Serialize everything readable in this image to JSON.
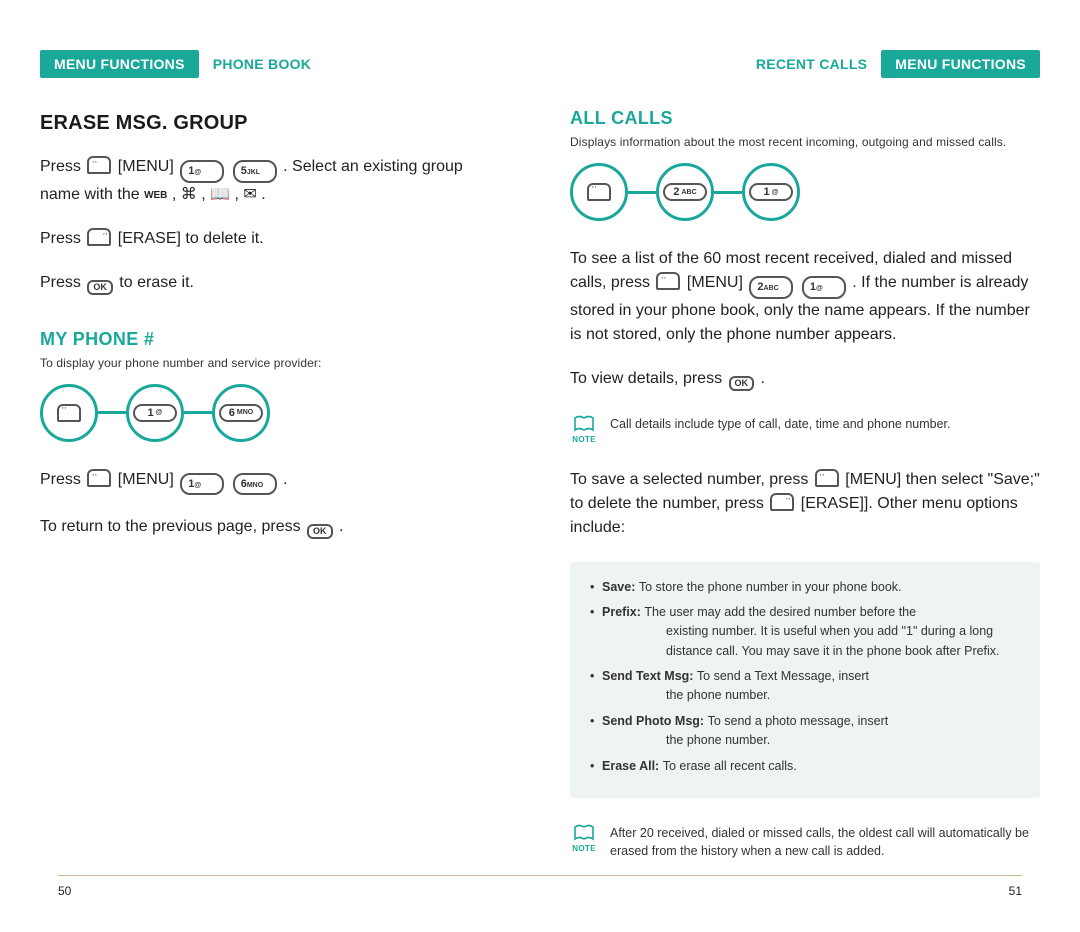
{
  "left": {
    "header": {
      "pill": "MENU FUNCTIONS",
      "sub": "PHONE BOOK"
    },
    "title": "ERASE MSG. GROUP",
    "erase_line1a": "Press ",
    "erase_line1b": " [MENU] ",
    "erase_line1c": " . Select an existing group",
    "erase_line2a": "name with the ",
    "erase_web": "WEB",
    "erase_glyphs": " , ⌘ , 📖 , ✉ .",
    "erase_line3a": "Press ",
    "erase_line3b": " [ERASE] to delete it.",
    "erase_line4a": "Press ",
    "erase_line4b": "  to erase it.",
    "myphone_title": "MY PHONE #",
    "myphone_desc": "To display your phone number and service provider:",
    "steps": {
      "k2": {
        "main": "1",
        "sub": "@"
      },
      "k3": {
        "main": "6",
        "sub": "MNO"
      }
    },
    "p1a": "Press ",
    "p1b": " [MENU] ",
    "p1c": " .",
    "p2a": "To return to the previous page, press ",
    "p2b": "  .",
    "page": "50"
  },
  "right": {
    "header": {
      "sub": "RECENT CALLS",
      "pill": "MENU FUNCTIONS"
    },
    "title": "ALL CALLS",
    "desc": "Displays information about the most recent incoming, outgoing and missed calls.",
    "steps": {
      "k2": {
        "main": "2",
        "sub": "ABC"
      },
      "k3": {
        "main": "1",
        "sub": "@"
      }
    },
    "body1a": "To see a list of the 60 most recent received, dialed and missed calls, press ",
    "body1b": " [MENU] ",
    "body1c": " . If the number is already stored in your phone book, only the name appears. If the number is not stored, only the phone number appears.",
    "body2a": "To view details, press ",
    "body2b": "  .",
    "note1": "Call details include type of call, date, time and phone number.",
    "body3a": "To save a selected number, press ",
    "body3b": " [MENU] then select \"Save;\" to delete the number, press ",
    "body3c": " [ERASE]].  Other menu options include:",
    "options": [
      {
        "name": "Save:",
        "text": "To store the phone number in your phone book."
      },
      {
        "name": "Prefix:",
        "text": "The user may add the desired number before the existing number. It is useful when you add \"1\" during a long distance call. You may save it in the phone book after Prefix."
      },
      {
        "name": "Send Text Msg:",
        "text": "To send a Text Message, insert the phone number."
      },
      {
        "name": "Send Photo Msg:",
        "text": "To send a photo message, insert the phone number."
      },
      {
        "name": "Erase All:",
        "text": "To erase all recent calls."
      }
    ],
    "note2": "After 20 received, dialed or missed calls, the oldest call will automatically be erased from the history when a new call is added.",
    "page": "51"
  },
  "key": {
    "one": {
      "main": "1",
      "sub": "@"
    },
    "two": {
      "main": "2",
      "sub": "ABC"
    },
    "five": {
      "main": "5",
      "sub": "JKL"
    },
    "six": {
      "main": "6",
      "sub": "MNO"
    }
  },
  "ok": "OK",
  "note_label": "NOTE"
}
